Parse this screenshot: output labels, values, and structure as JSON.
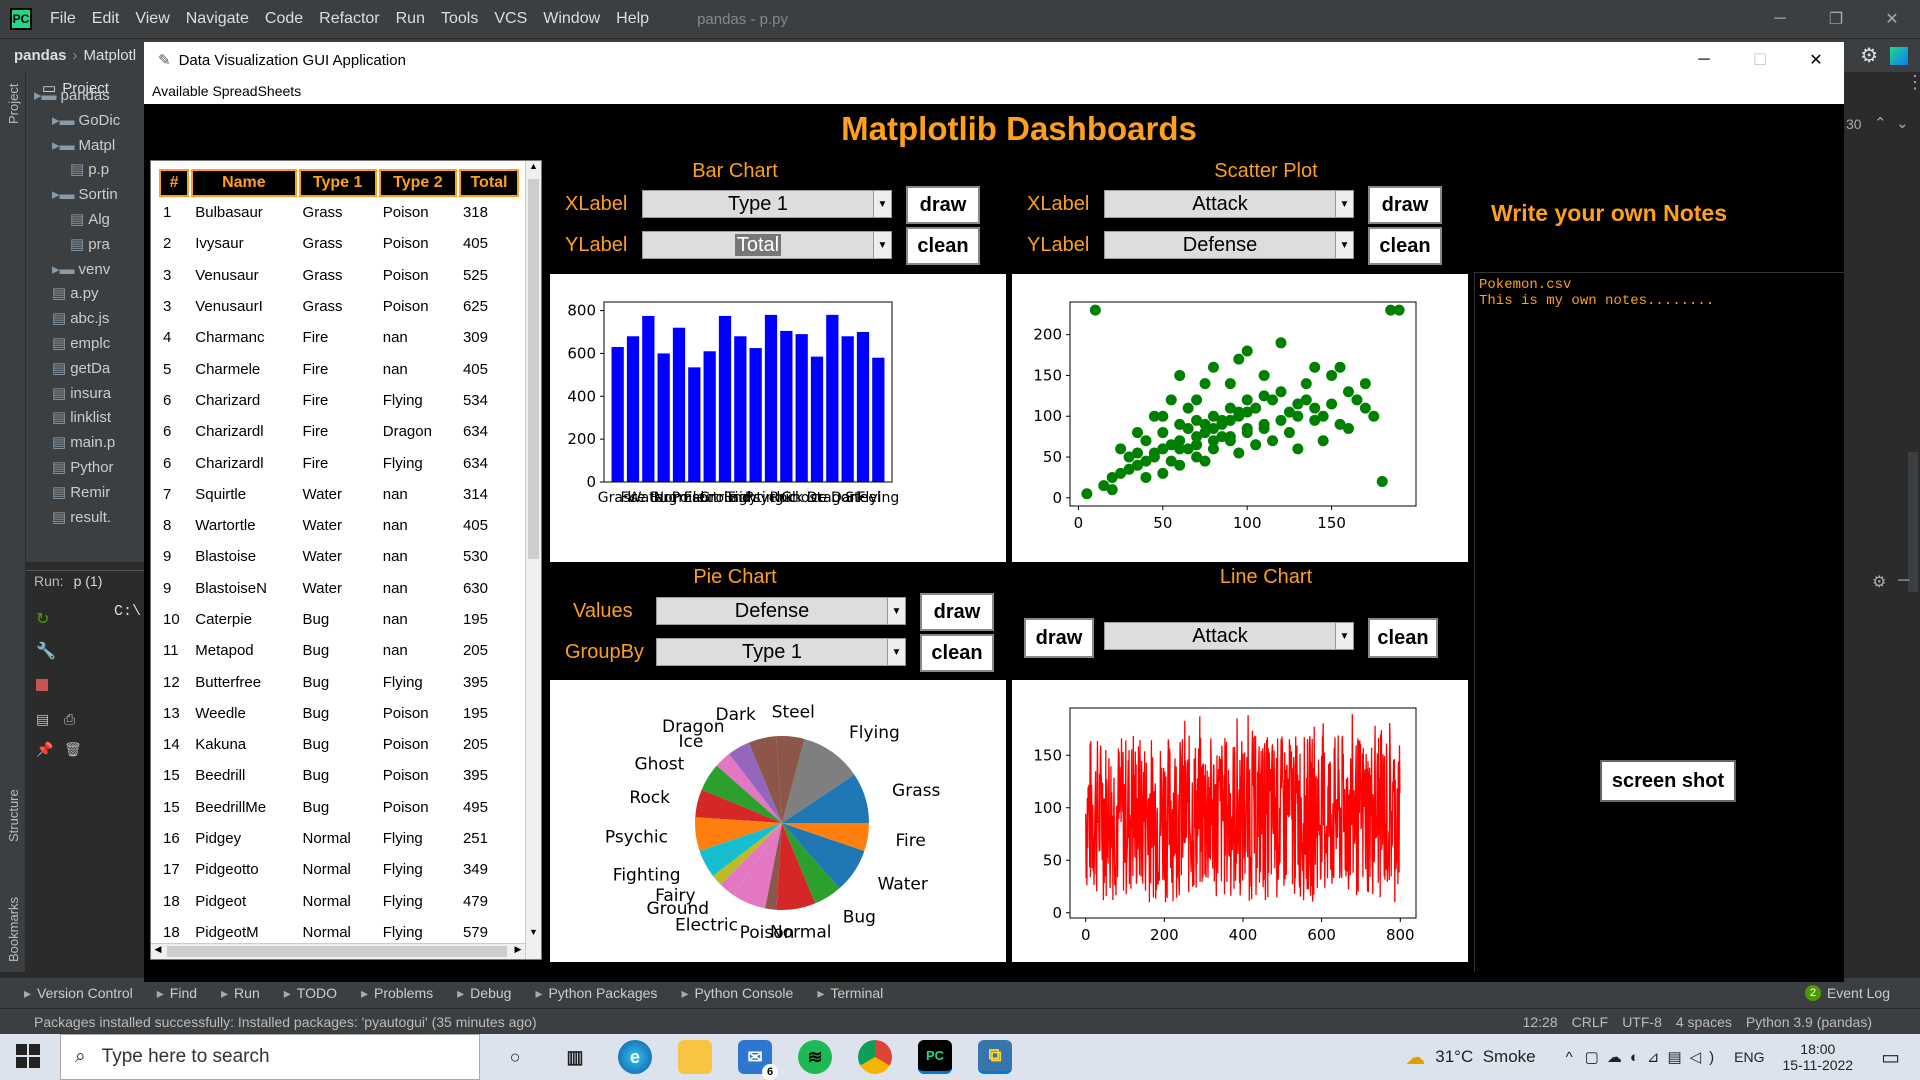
{
  "ide": {
    "menu": [
      "File",
      "Edit",
      "View",
      "Navigate",
      "Code",
      "Refactor",
      "Run",
      "Tools",
      "VCS",
      "Window",
      "Help"
    ],
    "title": "pandas - p.py",
    "breadcrumb_project": "pandas",
    "breadcrumb_file": "Matplotl",
    "project_label": "Project",
    "tree": [
      {
        "label": "pandas",
        "indent": 0
      },
      {
        "label": "GoDic",
        "indent": 1
      },
      {
        "label": "Matpl",
        "indent": 1
      },
      {
        "label": "p.p",
        "indent": 2
      },
      {
        "label": "Sortin",
        "indent": 1
      },
      {
        "label": "Alg",
        "indent": 2
      },
      {
        "label": "pra",
        "indent": 2
      },
      {
        "label": "venv",
        "indent": 1
      },
      {
        "label": "a.py",
        "indent": 1
      },
      {
        "label": "abc.js",
        "indent": 1
      },
      {
        "label": "emplc",
        "indent": 1
      },
      {
        "label": "getDa",
        "indent": 1
      },
      {
        "label": "insura",
        "indent": 1
      },
      {
        "label": "linklist",
        "indent": 1
      },
      {
        "label": "main.p",
        "indent": 1
      },
      {
        "label": "Pythor",
        "indent": 1
      },
      {
        "label": "Remir",
        "indent": 1
      },
      {
        "label": "result.",
        "indent": 1
      }
    ],
    "run_label": "Run:",
    "run_tab": "p (1)",
    "run_output": "C:\\",
    "line_number": "30",
    "side_labels": {
      "project": "Project",
      "structure": "Structure",
      "bookmarks": "Bookmarks"
    },
    "bottom_tools": [
      "Version Control",
      "Find",
      "Run",
      "TODO",
      "Problems",
      "Debug",
      "Python Packages",
      "Python Console",
      "Terminal"
    ],
    "event_log": "Event Log",
    "event_count": "2",
    "status_message": "Packages installed successfully: Installed packages: 'pyautogui' (35 minutes ago)",
    "status_right": [
      "12:28",
      "CRLF",
      "UTF-8",
      "4 spaces",
      "Python 3.9 (pandas)"
    ]
  },
  "taskbar": {
    "search_placeholder": "Type here to search",
    "weather": "31°C  Smoke",
    "lang": "ENG",
    "time": "18:00",
    "date": "15-11-2022",
    "mail_badge": "6"
  },
  "app": {
    "window_title": "Data Visualization GUI Application",
    "menu": "Available SpreadSheets",
    "dashboard_title": "Matplotlib Dashboards",
    "table": {
      "headers": [
        "#",
        "Name",
        "Type 1",
        "Type 2",
        "Total"
      ],
      "rows": [
        [
          "1",
          "Bulbasaur",
          "Grass",
          "Poison",
          "318"
        ],
        [
          "2",
          "Ivysaur",
          "Grass",
          "Poison",
          "405"
        ],
        [
          "3",
          "Venusaur",
          "Grass",
          "Poison",
          "525"
        ],
        [
          "3",
          "VenusaurI",
          "Grass",
          "Poison",
          "625"
        ],
        [
          "4",
          "Charmanc",
          "Fire",
          "nan",
          "309"
        ],
        [
          "5",
          "Charmele",
          "Fire",
          "nan",
          "405"
        ],
        [
          "6",
          "Charizard",
          "Fire",
          "Flying",
          "534"
        ],
        [
          "6",
          "Charizardl",
          "Fire",
          "Dragon",
          "634"
        ],
        [
          "6",
          "Charizardl",
          "Fire",
          "Flying",
          "634"
        ],
        [
          "7",
          "Squirtle",
          "Water",
          "nan",
          "314"
        ],
        [
          "8",
          "Wartortle",
          "Water",
          "nan",
          "405"
        ],
        [
          "9",
          "Blastoise",
          "Water",
          "nan",
          "530"
        ],
        [
          "9",
          "BlastoiseN",
          "Water",
          "nan",
          "630"
        ],
        [
          "10",
          "Caterpie",
          "Bug",
          "nan",
          "195"
        ],
        [
          "11",
          "Metapod",
          "Bug",
          "nan",
          "205"
        ],
        [
          "12",
          "Butterfree",
          "Bug",
          "Flying",
          "395"
        ],
        [
          "13",
          "Weedle",
          "Bug",
          "Poison",
          "195"
        ],
        [
          "14",
          "Kakuna",
          "Bug",
          "Poison",
          "205"
        ],
        [
          "15",
          "Beedrill",
          "Bug",
          "Poison",
          "395"
        ],
        [
          "15",
          "BeedrillMe",
          "Bug",
          "Poison",
          "495"
        ],
        [
          "16",
          "Pidgey",
          "Normal",
          "Flying",
          "251"
        ],
        [
          "17",
          "Pidgeotto",
          "Normal",
          "Flying",
          "349"
        ],
        [
          "18",
          "Pidgeot",
          "Normal",
          "Flying",
          "479"
        ],
        [
          "18",
          "PidgeotM",
          "Normal",
          "Flying",
          "579"
        ]
      ]
    },
    "bar_panel": {
      "title": "Bar Chart",
      "xlabel": "XLabel",
      "ylabel": "YLabel",
      "x_value": "Type 1",
      "y_value": "Total",
      "draw": "draw",
      "clean": "clean"
    },
    "scatter_panel": {
      "title": "Scatter Plot",
      "xlabel": "XLabel",
      "ylabel": "YLabel",
      "x_value": "Attack",
      "y_value": "Defense",
      "draw": "draw",
      "clean": "clean"
    },
    "pie_panel": {
      "title": "Pie Chart",
      "values_label": "Values",
      "groupby_label": "GroupBy",
      "values_value": "Defense",
      "groupby_value": "Type 1",
      "draw": "draw",
      "clean": "clean"
    },
    "line_panel": {
      "title": "Line Chart",
      "value": "Attack",
      "draw": "draw",
      "clean": "clean"
    },
    "notes": {
      "title": "Write your own Notes",
      "text": "Pokemon.csv\nThis is my own notes........"
    },
    "screenshot_button": "screen shot"
  },
  "chart_data": [
    {
      "type": "bar",
      "categories": [
        "Grass",
        "Fire",
        "Water",
        "Bug",
        "Normal",
        "Poison",
        "Electric",
        "Ground",
        "Fairy",
        "Fighting",
        "Psychic",
        "Rock",
        "Ghost",
        "Ice",
        "Dragon",
        "Dark",
        "Steel",
        "Flying"
      ],
      "values": [
        630,
        680,
        775,
        600,
        720,
        535,
        610,
        775,
        680,
        625,
        780,
        705,
        690,
        585,
        780,
        680,
        700,
        580
      ],
      "ylim": [
        0,
        840
      ],
      "yticks": [
        0,
        200,
        400,
        600,
        800
      ],
      "color": "#0000ff"
    },
    {
      "type": "scatter",
      "xticks": [
        0,
        50,
        100,
        150
      ],
      "yticks": [
        0,
        50,
        100,
        150,
        200
      ],
      "xlim": [
        -5,
        200
      ],
      "ylim": [
        -10,
        240
      ],
      "color": "#008000",
      "points": [
        [
          10,
          230
        ],
        [
          185,
          230
        ],
        [
          190,
          230
        ],
        [
          5,
          5
        ],
        [
          15,
          15
        ],
        [
          20,
          25
        ],
        [
          25,
          30
        ],
        [
          30,
          35
        ],
        [
          35,
          40
        ],
        [
          40,
          45
        ],
        [
          45,
          55
        ],
        [
          50,
          60
        ],
        [
          55,
          65
        ],
        [
          60,
          70
        ],
        [
          65,
          60
        ],
        [
          70,
          75
        ],
        [
          75,
          80
        ],
        [
          80,
          85
        ],
        [
          85,
          90
        ],
        [
          90,
          95
        ],
        [
          95,
          100
        ],
        [
          100,
          105
        ],
        [
          105,
          110
        ],
        [
          110,
          90
        ],
        [
          115,
          120
        ],
        [
          120,
          130
        ],
        [
          125,
          80
        ],
        [
          130,
          115
        ],
        [
          135,
          140
        ],
        [
          140,
          95
        ],
        [
          145,
          100
        ],
        [
          150,
          150
        ],
        [
          155,
          160
        ],
        [
          160,
          85
        ],
        [
          165,
          120
        ],
        [
          170,
          110
        ],
        [
          175,
          100
        ],
        [
          180,
          20
        ],
        [
          60,
          150
        ],
        [
          80,
          160
        ],
        [
          100,
          180
        ],
        [
          120,
          190
        ],
        [
          95,
          170
        ],
        [
          75,
          140
        ],
        [
          55,
          120
        ],
        [
          45,
          100
        ],
        [
          35,
          80
        ],
        [
          25,
          60
        ],
        [
          30,
          50
        ],
        [
          40,
          70
        ],
        [
          50,
          80
        ],
        [
          60,
          90
        ],
        [
          70,
          95
        ],
        [
          80,
          100
        ],
        [
          90,
          110
        ],
        [
          100,
          120
        ],
        [
          110,
          125
        ],
        [
          60,
          40
        ],
        [
          70,
          50
        ],
        [
          80,
          60
        ],
        [
          90,
          70
        ],
        [
          100,
          80
        ],
        [
          110,
          85
        ],
        [
          120,
          95
        ],
        [
          130,
          100
        ],
        [
          140,
          110
        ],
        [
          50,
          30
        ],
        [
          40,
          25
        ],
        [
          20,
          10
        ],
        [
          65,
          110
        ],
        [
          85,
          75
        ],
        [
          105,
          65
        ],
        [
          115,
          70
        ],
        [
          125,
          105
        ],
        [
          135,
          120
        ],
        [
          95,
          55
        ],
        [
          75,
          45
        ],
        [
          55,
          45
        ],
        [
          45,
          50
        ],
        [
          35,
          55
        ],
        [
          150,
          115
        ],
        [
          160,
          130
        ],
        [
          170,
          140
        ],
        [
          145,
          70
        ],
        [
          155,
          90
        ],
        [
          130,
          60
        ],
        [
          110,
          150
        ],
        [
          90,
          140
        ],
        [
          70,
          120
        ],
        [
          140,
          160
        ],
        [
          50,
          100
        ],
        [
          60,
          60
        ],
        [
          70,
          65
        ],
        [
          80,
          70
        ],
        [
          90,
          75
        ],
        [
          100,
          85
        ],
        [
          65,
          85
        ],
        [
          75,
          90
        ],
        [
          85,
          95
        ],
        [
          95,
          105
        ]
      ]
    },
    {
      "type": "pie",
      "labels": [
        "Grass",
        "Flying",
        "Steel",
        "Dark",
        "Dragon",
        "Ice",
        "Ghost",
        "Rock",
        "Psychic",
        "Fighting",
        "Fairy",
        "Ground",
        "Electric",
        "Poison",
        "Normal",
        "Bug",
        "Water",
        "Fire"
      ],
      "values": [
        9,
        11,
        5,
        5,
        4,
        3,
        5,
        5,
        6,
        5,
        2,
        3,
        6,
        2,
        7,
        5,
        8,
        5
      ],
      "colors": [
        "#1f77b4",
        "#7f7f7f",
        "#8c564b",
        "#8c564b",
        "#9467bd",
        "#e377c2",
        "#2ca02c",
        "#d62728",
        "#ff7f0e",
        "#17becf",
        "#bcbd22",
        "#e377c2",
        "#e377c2",
        "#8c564b",
        "#d62728",
        "#2ca02c",
        "#1f77b4",
        "#ff7f0e"
      ]
    },
    {
      "type": "line",
      "xticks": [
        0,
        200,
        400,
        600,
        800
      ],
      "yticks": [
        0,
        50,
        100,
        150
      ],
      "xlim": [
        -40,
        840
      ],
      "ylim": [
        -5,
        195
      ],
      "color": "#ff0000",
      "n": 800
    }
  ]
}
